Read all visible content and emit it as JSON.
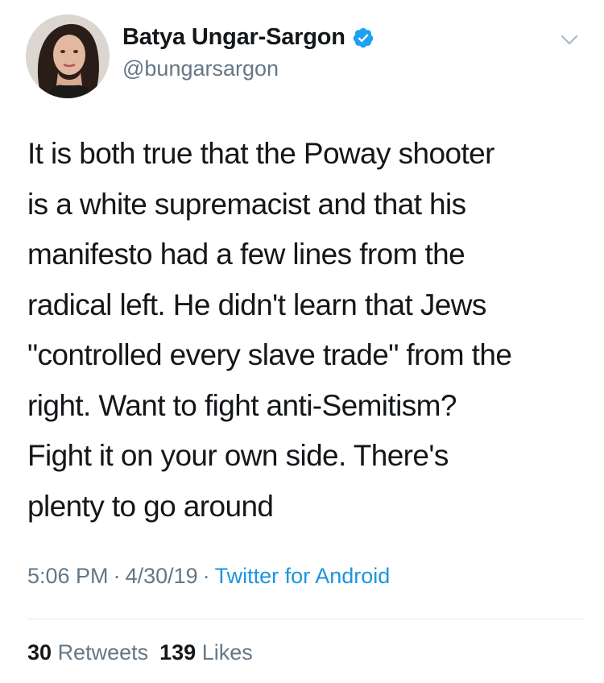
{
  "author": {
    "display_name": "Batya Ungar-Sargon",
    "handle": "@bungarsargon",
    "verified": true,
    "verified_color": "#1da1f2"
  },
  "tweet": {
    "lines": [
      "It is both true that the Poway shooter",
      "is a white supremacist and that his",
      "manifesto had a few lines from the",
      "radical left. He didn't learn that Jews",
      "\"controlled every slave trade\" from the",
      "right. Want to fight anti-Semitism?",
      "Fight it on your own side. There's",
      "plenty to go around"
    ]
  },
  "meta": {
    "time": "5:06 PM",
    "separator": "·",
    "date": "4/30/19",
    "source": "Twitter for Android",
    "source_color": "#1b95e0"
  },
  "stats": {
    "retweets_count": "30",
    "retweets_label": "Retweets",
    "likes_count": "139",
    "likes_label": "Likes"
  },
  "icons": {
    "menu": "chevron-down-icon",
    "verified": "verified-badge-icon",
    "avatar": "avatar"
  }
}
